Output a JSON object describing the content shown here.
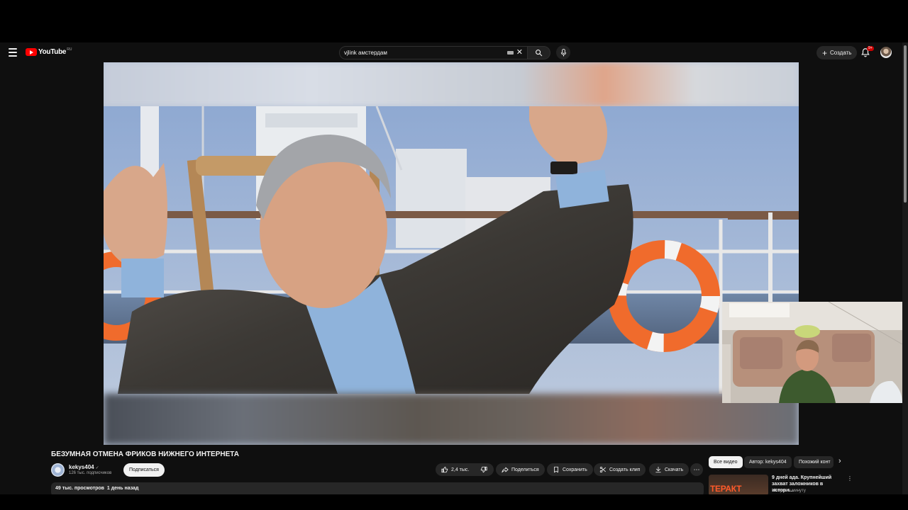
{
  "masthead": {
    "logo_text": "YouTube",
    "logo_region": "RU",
    "search_value": "vjlink амстердам",
    "create_label": "Создать",
    "notification_badge": "9+"
  },
  "video": {
    "title": "БЕЗУМНАЯ ОТМЕНА ФРИКОВ НИЖНЕГО ИНТЕРНЕТА"
  },
  "channel": {
    "name": "kekys404",
    "verified_icon": "✓",
    "subscribers": "126 тыс. подписчиков",
    "subscribe_label": "Подписаться"
  },
  "actions": {
    "likes": "2,4 тыс.",
    "share": "Поделиться",
    "save": "Сохранить",
    "clip": "Создать клип",
    "download": "Скачать",
    "more": "⋯"
  },
  "description": {
    "views": "49 тыс. просмотров",
    "date": "1 день назад"
  },
  "rail": {
    "chips": [
      "Все видео",
      "Автор: kekys404",
      "Похожий конт"
    ],
    "next_arrow": "›",
    "recommendation": {
      "thumb_text": "ТЕРАКТ",
      "title": "9 дней ада. Крупнейший захват заложников в истори...",
      "meta": "Минуты в минуту",
      "menu": "⋮"
    }
  },
  "colors": {
    "background": "#0f0f0f",
    "brand_red": "#ff0000",
    "pill": "#272727",
    "text": "#f1f1f1",
    "muted": "#aaaaaa"
  },
  "icons": [
    "menu-icon",
    "youtube-logo-icon",
    "keyboard-icon",
    "clear-icon",
    "search-icon",
    "mic-icon",
    "plus-icon",
    "bell-icon",
    "like-icon",
    "dislike-icon",
    "share-icon",
    "save-icon",
    "scissors-icon",
    "download-icon",
    "more-icon",
    "chevron-right-icon"
  ]
}
